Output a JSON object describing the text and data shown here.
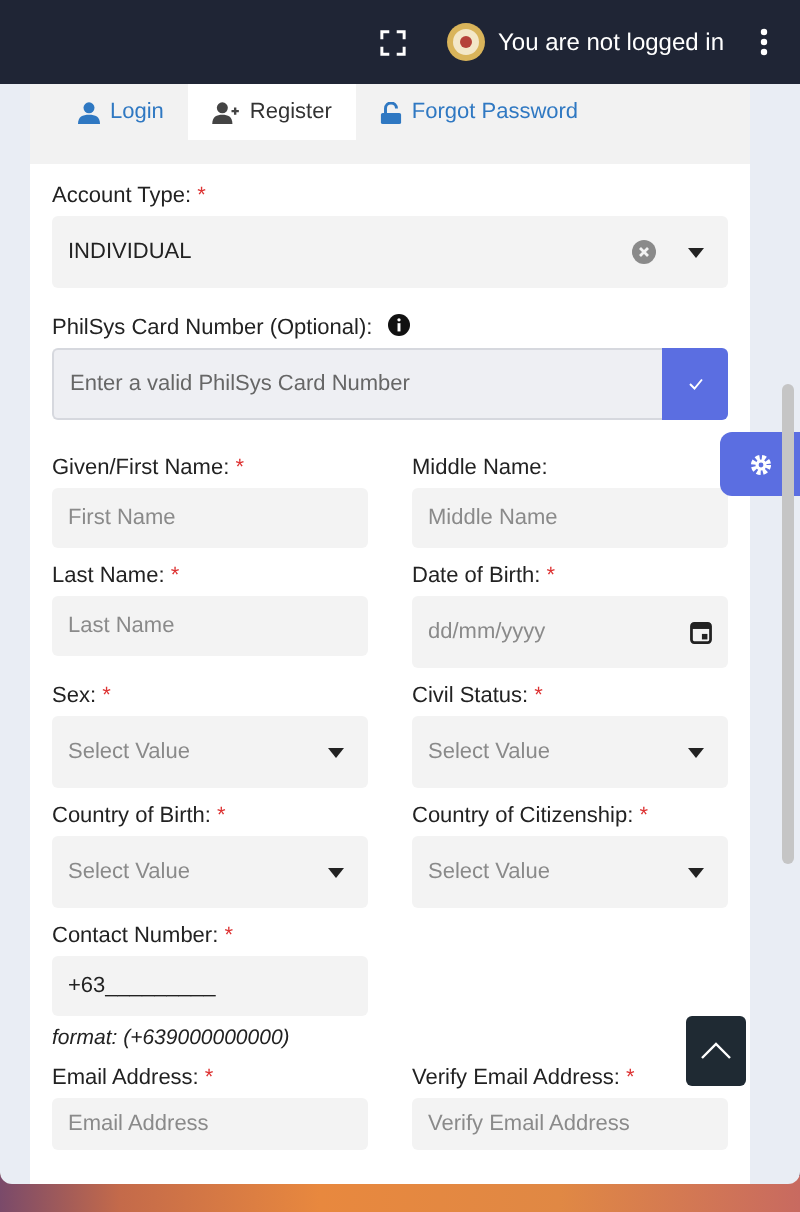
{
  "header": {
    "user_status": "You are not logged in"
  },
  "tabs": [
    {
      "label": "Login",
      "selected": false
    },
    {
      "label": "Register",
      "selected": true
    },
    {
      "label": "Forgot Password",
      "selected": false
    }
  ],
  "account_type": {
    "label": "Account Type:",
    "required_mark": "*",
    "value": "INDIVIDUAL"
  },
  "philsys": {
    "label": "PhilSys Card Number (Optional):",
    "placeholder": "Enter a valid PhilSys Card Number"
  },
  "fields": [
    {
      "kind": "text",
      "label": "Given/First Name:",
      "required_mark": "*",
      "placeholder": "First Name"
    },
    {
      "kind": "text",
      "label": "Middle Name:",
      "placeholder": "Middle Name"
    },
    {
      "kind": "text",
      "label": "Last Name:",
      "required_mark": "*",
      "placeholder": "Last Name"
    },
    {
      "kind": "date",
      "label": "Date of Birth:",
      "required_mark": "*",
      "placeholder": "dd/mm/yyyy"
    },
    {
      "kind": "select",
      "label": "Sex:",
      "required_mark": "*",
      "placeholder": "Select Value"
    },
    {
      "kind": "select",
      "label": "Civil Status:",
      "required_mark": "*",
      "placeholder": "Select Value"
    },
    {
      "kind": "select",
      "label": "Country of Birth:",
      "required_mark": "*",
      "placeholder": "Select Value"
    },
    {
      "kind": "select",
      "label": "Country of Citizenship:",
      "required_mark": "*",
      "placeholder": "Select Value"
    },
    {
      "kind": "text",
      "label": "Contact Number:",
      "required_mark": "*",
      "value": "+63_________",
      "hint": "format: (+639000000000)"
    },
    {
      "kind": "spacer"
    },
    {
      "kind": "text",
      "label": "Email Address:",
      "required_mark": "*",
      "placeholder": "Email Address"
    },
    {
      "kind": "text",
      "label": "Verify Email Address:",
      "required_mark": "*",
      "placeholder": "Verify Email Address"
    }
  ]
}
